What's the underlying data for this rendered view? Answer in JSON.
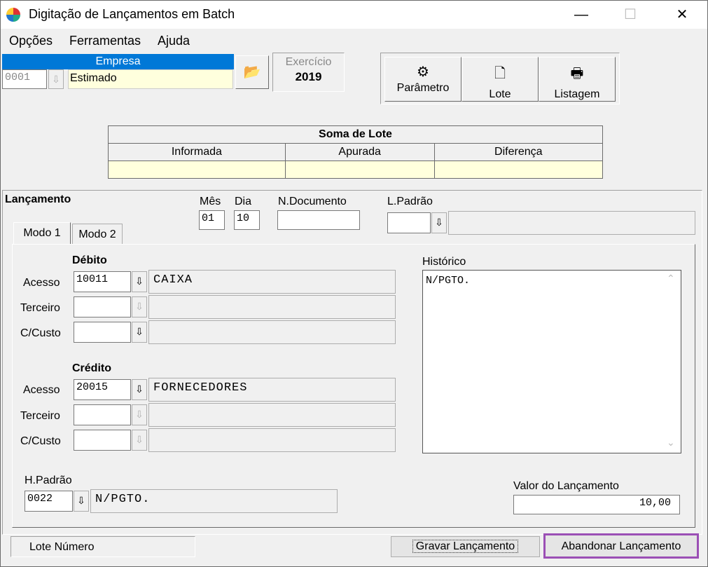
{
  "window": {
    "title": "Digitação de Lançamentos em Batch",
    "minimize": "—",
    "maximize": "☐",
    "close": "✕"
  },
  "menu": {
    "opcoes": "Opções",
    "ferramentas": "Ferramentas",
    "ajuda": "Ajuda"
  },
  "empresa": {
    "label": "Empresa",
    "code": "0001",
    "name": "Estimado"
  },
  "exercicio": {
    "label": "Exercício",
    "year": "2019"
  },
  "toolbar": {
    "parametro": "Parâmetro",
    "lote": "Lote",
    "listagem": "Listagem"
  },
  "soma": {
    "title": "Soma de Lote",
    "informada": "Informada",
    "apurada": "Apurada",
    "diferenca": "Diferença",
    "informada_value": "",
    "apurada_value": "",
    "diferenca_value": ""
  },
  "lancamento": {
    "label": "Lançamento",
    "mes_label": "Mês",
    "mes": "01",
    "dia_label": "Dia",
    "dia": "10",
    "ndoc_label": "N.Documento",
    "ndoc": "",
    "lpadrao_label": "L.Padrão",
    "lpadrao": "",
    "lpadrao_desc": ""
  },
  "tabs": {
    "modo1": "Modo 1",
    "modo2": "Modo 2"
  },
  "debito": {
    "label": "Débito",
    "acesso_label": "Acesso",
    "acesso": "10011",
    "acesso_desc": "CAIXA",
    "terceiro_label": "Terceiro",
    "terceiro": "",
    "terceiro_desc": "",
    "ccusto_label": "C/Custo",
    "ccusto": "",
    "ccusto_desc": ""
  },
  "credito": {
    "label": "Crédito",
    "acesso_label": "Acesso",
    "acesso": "20015",
    "acesso_desc": "FORNECEDORES",
    "terceiro_label": "Terceiro",
    "terceiro": "",
    "terceiro_desc": "",
    "ccusto_label": "C/Custo",
    "ccusto": "",
    "ccusto_desc": ""
  },
  "historico": {
    "label": "Histórico",
    "text": "N/PGTO."
  },
  "hpadrao": {
    "label": "H.Padrão",
    "code": "0022",
    "desc": "N/PGTO."
  },
  "valor": {
    "label": "Valor do Lançamento",
    "value": "10,00"
  },
  "footer": {
    "lote_numero": "Lote Número",
    "gravar": "Gravar Lançamento",
    "abandonar": "Abandonar Lançamento"
  },
  "icons": {
    "dropdown": "⇩"
  }
}
